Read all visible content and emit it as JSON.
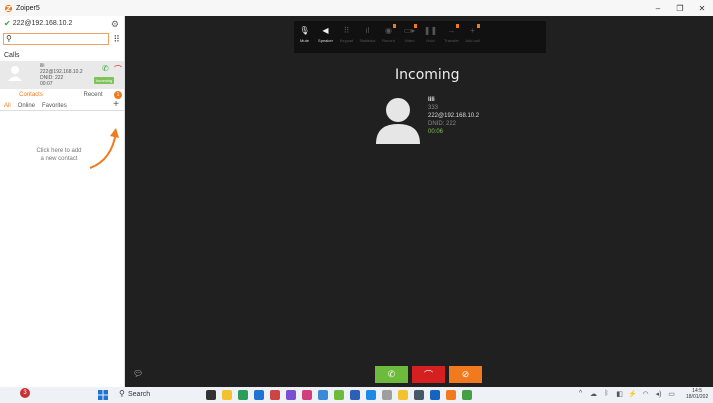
{
  "window": {
    "title": "Zoiper5",
    "controls": {
      "minimize": "–",
      "restore": "❐",
      "close": "✕"
    }
  },
  "sidebar": {
    "account": "222@192.168.10.2",
    "search": {
      "value": "",
      "placeholder": ""
    },
    "calls_label": "Calls",
    "call_item": {
      "name": "lili",
      "uri": "222@192.168.10.2",
      "dnid": "DNID: 222",
      "duration": "00:07",
      "badge": "Incoming"
    },
    "tabs": {
      "contacts": "Contacts",
      "recent": "Recent",
      "recent_count": "1"
    },
    "filters": [
      "All",
      "Online",
      "Favorites"
    ],
    "hint": "Click here to add a new contact"
  },
  "toolbar": [
    {
      "icon": "microphone-icon",
      "label": "Mute",
      "enabled": true,
      "marked": false
    },
    {
      "icon": "speaker-icon",
      "label": "Speaker",
      "enabled": true,
      "marked": false
    },
    {
      "icon": "keypad-icon",
      "label": "Keypad",
      "enabled": false,
      "marked": false
    },
    {
      "icon": "statistics-icon",
      "label": "Statistics",
      "enabled": false,
      "marked": false
    },
    {
      "icon": "record-icon",
      "label": "Record",
      "enabled": false,
      "marked": true
    },
    {
      "icon": "video-icon",
      "label": "Video",
      "enabled": false,
      "marked": true
    },
    {
      "icon": "hold-icon",
      "label": "Hold",
      "enabled": false,
      "marked": false
    },
    {
      "icon": "transfer-icon",
      "label": "Transfer",
      "enabled": false,
      "marked": true
    },
    {
      "icon": "add-call-icon",
      "label": "Add call",
      "enabled": false,
      "marked": true
    }
  ],
  "call": {
    "state": "Incoming",
    "caller_name": "lili",
    "caller_number": "333",
    "caller_uri": "222@192.168.10.2",
    "dnid": "DNID: 222",
    "timer": "00:06"
  },
  "taskbar": {
    "notification_count": "3",
    "search_label": "Search",
    "time": "14:5",
    "date": "18/01/202"
  },
  "colors": {
    "accent": "#f07a1d",
    "answer": "#6dbb3c",
    "decline": "#d61f1f",
    "call_bg": "#202020"
  }
}
